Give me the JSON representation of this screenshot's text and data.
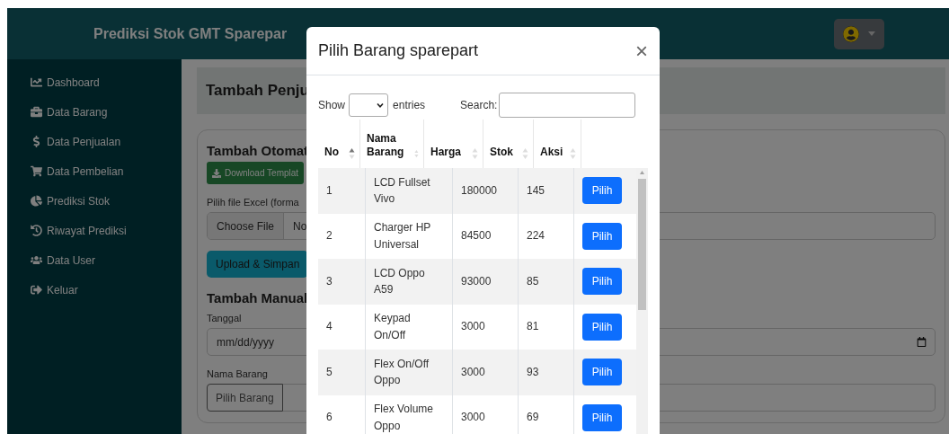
{
  "header": {
    "title": "Prediksi Stok GMT Sparepar"
  },
  "sidebar": {
    "items": [
      {
        "label": "Dashboard"
      },
      {
        "label": "Data Barang"
      },
      {
        "label": "Data Penjualan"
      },
      {
        "label": "Data Pembelian"
      },
      {
        "label": "Prediksi Stok"
      },
      {
        "label": "Riwayat Prediksi"
      },
      {
        "label": "Data User"
      },
      {
        "label": "Keluar"
      }
    ]
  },
  "page_heading": "Tambah Penju",
  "auto_section": {
    "title": "Tambah Otomat",
    "download_button": "Download Templat",
    "file_label": "Pilih file Excel (forma",
    "choose_button": "Choose File",
    "file_status": "No",
    "upload_button": "Upload & Simpan"
  },
  "manual_section": {
    "title": "Tambah Manual",
    "date_label": "Tanggal",
    "date_field": {
      "placeholder": "mm/dd/yyyy"
    },
    "item_label": "Nama Barang",
    "pick_button": "Pilih Barang"
  },
  "modal": {
    "title": "Pilih Barang sparepart",
    "close": "×",
    "show_label": "Show",
    "entries_label": "entries",
    "search_label": "Search:",
    "columns": [
      {
        "label": "No",
        "sorted": true
      },
      {
        "label": "Nama Barang",
        "sorted": false
      },
      {
        "label": "Harga",
        "sorted": false
      },
      {
        "label": "Stok",
        "sorted": false
      },
      {
        "label": "Aksi",
        "sorted": false
      }
    ],
    "rows": [
      {
        "no": "1",
        "name": "LCD Fullset Vivo",
        "price": "180000",
        "stock": "145",
        "action": "Pilih"
      },
      {
        "no": "2",
        "name": "Charger HP Universal",
        "price": "84500",
        "stock": "224",
        "action": "Pilih"
      },
      {
        "no": "3",
        "name": "LCD Oppo A59",
        "price": "93000",
        "stock": "85",
        "action": "Pilih"
      },
      {
        "no": "4",
        "name": "Keypad On/Off",
        "price": "3000",
        "stock": "81",
        "action": "Pilih"
      },
      {
        "no": "5",
        "name": "Flex On/Off Oppo",
        "price": "3000",
        "stock": "93",
        "action": "Pilih"
      },
      {
        "no": "6",
        "name": "Flex Volume Oppo",
        "price": "3000",
        "stock": "69",
        "action": "Pilih"
      }
    ]
  }
}
